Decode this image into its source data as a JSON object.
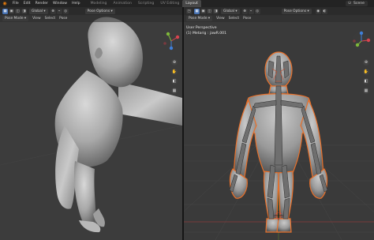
{
  "topbar": {
    "menus": [
      "File",
      "Edit",
      "Render",
      "Window",
      "Help"
    ],
    "tabs": [
      {
        "label": "Modeling",
        "active": false
      },
      {
        "label": "Animation",
        "active": false
      },
      {
        "label": "Scripting",
        "active": false
      },
      {
        "label": "UV Editing",
        "active": false
      },
      {
        "label": "Layout",
        "active": true
      }
    ],
    "scene": "Scene"
  },
  "left_view": {
    "orientation": "Global",
    "pose_options": "Pose Options",
    "mode": "Pose Mode",
    "menus": [
      "View",
      "Select",
      "Pose"
    ]
  },
  "right_view": {
    "orientation": "Global",
    "pose_options": "Pose Options",
    "mode": "Pose Mode",
    "menus": [
      "View",
      "Select",
      "Pose"
    ],
    "view_name": "User Perspective",
    "active_bone": "(1) Metarig : jawR.001"
  },
  "icons": {
    "accent": "#4772b3",
    "selection_outline": "#e8702a",
    "axis_x": "#d9434e",
    "axis_y": "#7fb83a",
    "axis_z": "#3f7fd9"
  }
}
